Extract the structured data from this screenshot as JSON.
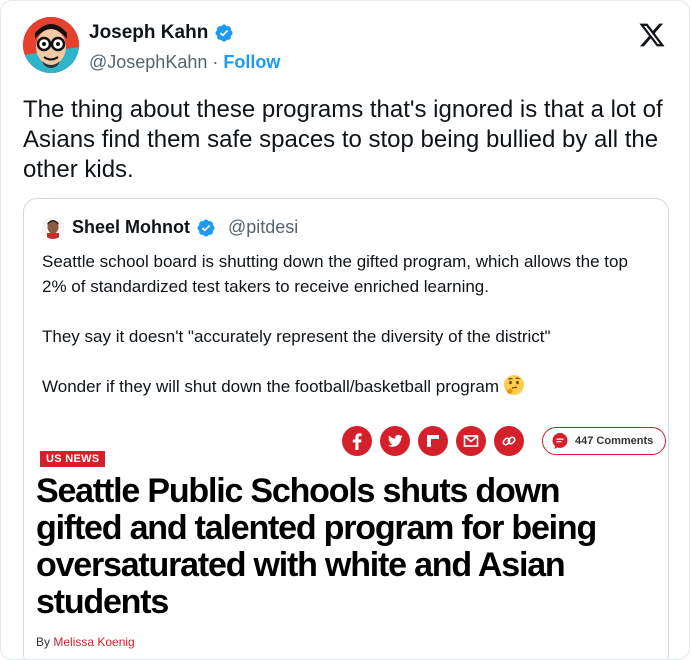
{
  "tweet": {
    "author_name": "Joseph Kahn",
    "author_handle": "@JosephKahn",
    "separator": "·",
    "follow_label": "Follow",
    "text": "The thing about these programs that's ignored is that a lot of Asians find them safe spaces to stop being bullied by all the other kids.",
    "verified_color": "#1d9bf0"
  },
  "quote": {
    "author_name": "Sheel Mohnot",
    "author_handle": "@pitdesi",
    "paragraphs": [
      "Seattle school board is shutting down the gifted program, which allows the top 2% of standardized test takers to receive enriched learning.",
      "They say it doesn't \"accurately represent the diversity of the district\"",
      "Wonder if they will shut down the football/basketball program"
    ],
    "emoji": "thinking-face"
  },
  "article": {
    "share_icons": [
      "facebook-icon",
      "twitter-icon",
      "flipboard-icon",
      "email-icon",
      "link-icon"
    ],
    "comments_label": "447 Comments",
    "section_tag": "US NEWS",
    "headline": "Seattle Public Schools shuts down gifted and talented program for being oversaturated with white and Asian students",
    "byline_prefix": "By",
    "byline_author": "Melissa Koenig",
    "accent_color": "#d4202a"
  }
}
